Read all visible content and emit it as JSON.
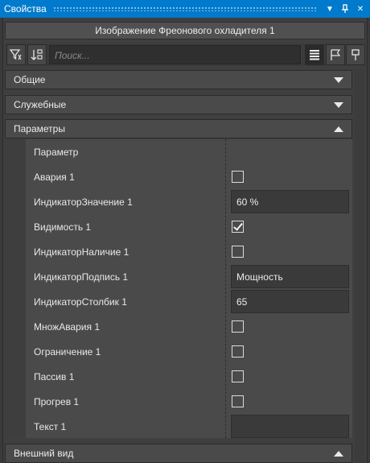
{
  "window": {
    "title": "Свойства"
  },
  "header": {
    "object_title": "Изображение Фреонового охладителя 1"
  },
  "toolbar": {
    "search_placeholder": "Поиск...",
    "left_icons": [
      "filter-icon",
      "sort-icon"
    ],
    "right_icons": [
      "list-view-icon",
      "flag-icon",
      "pin-icon"
    ]
  },
  "sections": {
    "general": {
      "label": "Общие",
      "expanded": false
    },
    "service": {
      "label": "Служебные",
      "expanded": false
    },
    "parameters": {
      "label": "Параметры",
      "expanded": true
    },
    "appearance": {
      "label": "Внешний вид",
      "expanded": true
    }
  },
  "parameters": {
    "header_label": "Параметр",
    "rows": [
      {
        "label": "Авария 1",
        "type": "checkbox",
        "checked": false
      },
      {
        "label": "ИндикаторЗначение 1",
        "type": "text",
        "value": "60 %"
      },
      {
        "label": "Видимость 1",
        "type": "checkbox",
        "checked": true
      },
      {
        "label": "ИндикаторНаличие 1",
        "type": "checkbox",
        "checked": false
      },
      {
        "label": "ИндикаторПодпись 1",
        "type": "text",
        "value": "Мощность"
      },
      {
        "label": "ИндикаторСтолбик 1",
        "type": "text",
        "value": "65"
      },
      {
        "label": "МножАвария 1",
        "type": "checkbox",
        "checked": false
      },
      {
        "label": "Ограничение 1",
        "type": "checkbox",
        "checked": false
      },
      {
        "label": "Пассив 1",
        "type": "checkbox",
        "checked": false
      },
      {
        "label": "Прогрев 1",
        "type": "checkbox",
        "checked": false
      },
      {
        "label": "Текст 1",
        "type": "text",
        "value": ""
      }
    ]
  },
  "colors": {
    "accent": "#007acc",
    "panel": "#3f3f3f",
    "row": "#4a4a4a"
  }
}
